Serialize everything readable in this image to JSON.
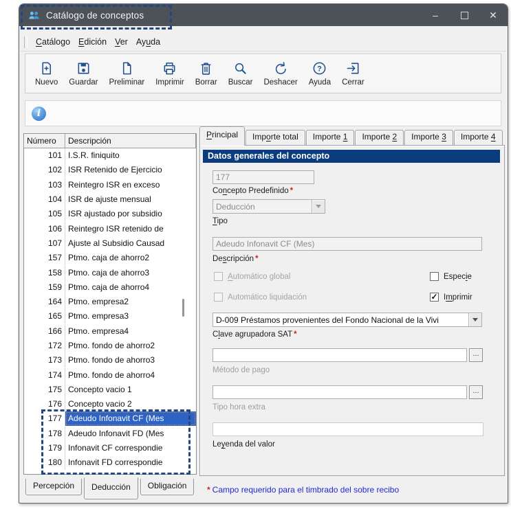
{
  "window": {
    "title": "Catálogo de conceptos",
    "controls": {
      "minimize": "–",
      "close": "✕"
    }
  },
  "menu": {
    "items": [
      {
        "pre": "",
        "key": "C",
        "post": "atálogo"
      },
      {
        "pre": "",
        "key": "E",
        "post": "dición"
      },
      {
        "pre": "",
        "key": "V",
        "post": "er"
      },
      {
        "pre": "Ay",
        "key": "u",
        "post": "da"
      }
    ]
  },
  "toolbar": {
    "buttons": [
      {
        "icon": "new-document-icon",
        "label": "Nuevo"
      },
      {
        "icon": "save-icon",
        "label": "Guardar"
      },
      {
        "icon": "preview-document-icon",
        "label": "Preliminar"
      },
      {
        "icon": "printer-icon",
        "label": "Imprimir"
      },
      {
        "icon": "trash-icon",
        "label": "Borrar"
      },
      {
        "icon": "search-icon",
        "label": "Buscar"
      },
      {
        "icon": "undo-icon",
        "label": "Deshacer"
      },
      {
        "icon": "help-icon",
        "label": "Ayuda"
      },
      {
        "icon": "exit-icon",
        "label": "Cerrar"
      }
    ]
  },
  "info_bar": {
    "icon": "info-icon",
    "glyph": "i"
  },
  "list": {
    "columns": [
      "Número",
      "Descripción"
    ],
    "selected_number": "177",
    "rows": [
      {
        "num": "101",
        "desc": "I.S.R. finiquito"
      },
      {
        "num": "102",
        "desc": "ISR Retenido de Ejercicio"
      },
      {
        "num": "103",
        "desc": "Reintegro ISR en exceso"
      },
      {
        "num": "104",
        "desc": "ISR de ajuste mensual"
      },
      {
        "num": "105",
        "desc": "ISR ajustado por subsidio"
      },
      {
        "num": "106",
        "desc": "Reintegro ISR retenido de"
      },
      {
        "num": "107",
        "desc": "Ajuste al Subsidio Causad"
      },
      {
        "num": "157",
        "desc": "Ptmo. caja de ahorro2"
      },
      {
        "num": "158",
        "desc": "Ptmo. caja de ahorro3"
      },
      {
        "num": "159",
        "desc": "Ptmo. caja de ahorro4"
      },
      {
        "num": "164",
        "desc": "Ptmo. empresa2"
      },
      {
        "num": "165",
        "desc": "Ptmo. empresa3"
      },
      {
        "num": "166",
        "desc": "Ptmo. empresa4"
      },
      {
        "num": "172",
        "desc": "Ptmo. fondo de ahorro2"
      },
      {
        "num": "173",
        "desc": "Ptmo. fondo de ahorro3"
      },
      {
        "num": "174",
        "desc": "Ptmo. fondo de ahorro4"
      },
      {
        "num": "175",
        "desc": "Concepto vacio 1"
      },
      {
        "num": "176",
        "desc": "Concepto vacio 2"
      },
      {
        "num": "177",
        "desc": "Adeudo Infonavit CF (Mes",
        "selected": true
      },
      {
        "num": "178",
        "desc": "Adeudo Infonavit FD (Mes"
      },
      {
        "num": "179",
        "desc": "Infonavit CF correspondie"
      },
      {
        "num": "180",
        "desc": "Infonavit FD correspondie"
      }
    ]
  },
  "tabs": {
    "items": [
      {
        "pre": "",
        "key": "P",
        "post": "rincipal",
        "active": true
      },
      {
        "pre": "Imp",
        "key": "o",
        "post": "rte total"
      },
      {
        "pre": "Importe ",
        "key": "1",
        "post": ""
      },
      {
        "pre": "Importe ",
        "key": "2",
        "post": ""
      },
      {
        "pre": "Importe ",
        "key": "3",
        "post": ""
      },
      {
        "pre": "Importe ",
        "key": "4",
        "post": ""
      }
    ]
  },
  "form": {
    "section_title": "Datos generales del concepto",
    "required_mark": "*",
    "check_glyph": "✓",
    "browse_label": "...",
    "concepto_predefinido": {
      "value": "177",
      "label": {
        "pre": "Co",
        "key": "n",
        "post": "cepto Predefinido"
      },
      "required": true
    },
    "tipo": {
      "value": "Deducción",
      "label": {
        "pre": "",
        "key": "T",
        "post": "ipo"
      }
    },
    "descripcion": {
      "value": "Adeudo Infonavit CF (Mes)",
      "label": {
        "pre": "De",
        "key": "s",
        "post": "cripción"
      },
      "required": true
    },
    "checkboxes": {
      "automatico_global": {
        "label": {
          "pre": "",
          "key": "A",
          "post": "utomático global"
        },
        "checked": false,
        "disabled": true
      },
      "especie": {
        "label": {
          "pre": "Espec",
          "key": "i",
          "post": "e"
        },
        "checked": false,
        "disabled": false
      },
      "automatico_liquidacion": {
        "label": {
          "pre": "Automático liquidación",
          "key": "",
          "post": ""
        },
        "checked": false,
        "disabled": true
      },
      "imprimir": {
        "label": {
          "pre": "I",
          "key": "m",
          "post": "primir"
        },
        "checked": true,
        "disabled": false
      }
    },
    "clave_sat": {
      "value": "D-009  Préstamos provenientes del Fondo Nacional de la Vivi",
      "label": {
        "pre": "C",
        "key": "l",
        "post": "ave agrupadora SAT"
      },
      "required": true
    },
    "metodo_pago": {
      "value": "",
      "label": {
        "pre": "Método de pago",
        "key": "",
        "post": ""
      }
    },
    "tipo_hora_extra": {
      "value": "",
      "label": {
        "pre": "Tipo hora extra",
        "key": "",
        "post": ""
      }
    },
    "leyenda": {
      "value": "",
      "label": {
        "pre": "Le",
        "key": "y",
        "post": "enda del valor"
      }
    }
  },
  "bottom_tabs": {
    "items": [
      {
        "label": "Percepción"
      },
      {
        "label": "Deducción",
        "active": true
      },
      {
        "label": "Obligación"
      }
    ]
  },
  "status": {
    "mark": "*",
    "text": "Campo requerido para el timbrado del sobre recibo"
  },
  "colors": {
    "titlebar": "#4c5257",
    "accent_navy": "#0a3c7e",
    "selection_blue": "#2e63c6",
    "icon_blue": "#1e4f8f",
    "status_text": "#2126d6",
    "required_red": "#d02020",
    "annotation_navy": "#24477f"
  }
}
